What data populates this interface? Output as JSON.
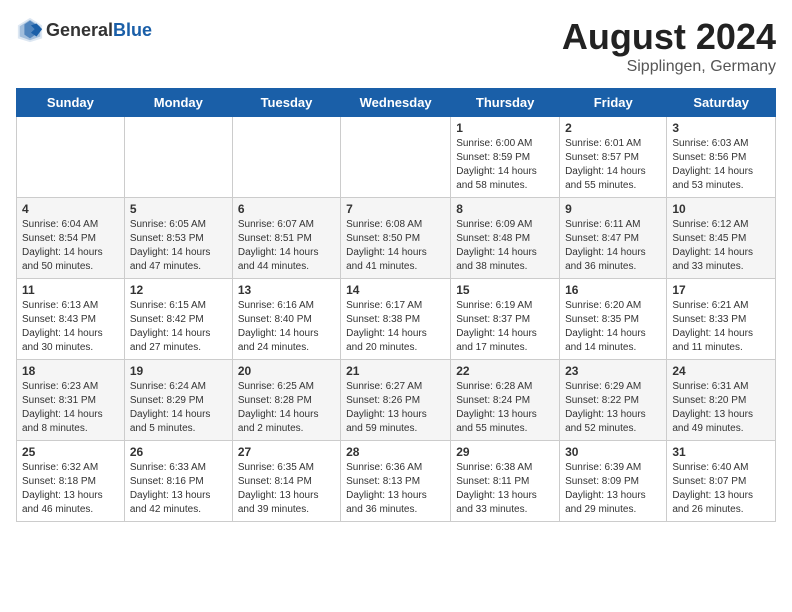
{
  "header": {
    "logo_general": "General",
    "logo_blue": "Blue",
    "month_year": "August 2024",
    "location": "Sipplingen, Germany"
  },
  "weekdays": [
    "Sunday",
    "Monday",
    "Tuesday",
    "Wednesday",
    "Thursday",
    "Friday",
    "Saturday"
  ],
  "weeks": [
    [
      {
        "day": "",
        "sunrise": "",
        "sunset": "",
        "daylight": ""
      },
      {
        "day": "",
        "sunrise": "",
        "sunset": "",
        "daylight": ""
      },
      {
        "day": "",
        "sunrise": "",
        "sunset": "",
        "daylight": ""
      },
      {
        "day": "",
        "sunrise": "",
        "sunset": "",
        "daylight": ""
      },
      {
        "day": "1",
        "sunrise": "Sunrise: 6:00 AM",
        "sunset": "Sunset: 8:59 PM",
        "daylight": "Daylight: 14 hours and 58 minutes."
      },
      {
        "day": "2",
        "sunrise": "Sunrise: 6:01 AM",
        "sunset": "Sunset: 8:57 PM",
        "daylight": "Daylight: 14 hours and 55 minutes."
      },
      {
        "day": "3",
        "sunrise": "Sunrise: 6:03 AM",
        "sunset": "Sunset: 8:56 PM",
        "daylight": "Daylight: 14 hours and 53 minutes."
      }
    ],
    [
      {
        "day": "4",
        "sunrise": "Sunrise: 6:04 AM",
        "sunset": "Sunset: 8:54 PM",
        "daylight": "Daylight: 14 hours and 50 minutes."
      },
      {
        "day": "5",
        "sunrise": "Sunrise: 6:05 AM",
        "sunset": "Sunset: 8:53 PM",
        "daylight": "Daylight: 14 hours and 47 minutes."
      },
      {
        "day": "6",
        "sunrise": "Sunrise: 6:07 AM",
        "sunset": "Sunset: 8:51 PM",
        "daylight": "Daylight: 14 hours and 44 minutes."
      },
      {
        "day": "7",
        "sunrise": "Sunrise: 6:08 AM",
        "sunset": "Sunset: 8:50 PM",
        "daylight": "Daylight: 14 hours and 41 minutes."
      },
      {
        "day": "8",
        "sunrise": "Sunrise: 6:09 AM",
        "sunset": "Sunset: 8:48 PM",
        "daylight": "Daylight: 14 hours and 38 minutes."
      },
      {
        "day": "9",
        "sunrise": "Sunrise: 6:11 AM",
        "sunset": "Sunset: 8:47 PM",
        "daylight": "Daylight: 14 hours and 36 minutes."
      },
      {
        "day": "10",
        "sunrise": "Sunrise: 6:12 AM",
        "sunset": "Sunset: 8:45 PM",
        "daylight": "Daylight: 14 hours and 33 minutes."
      }
    ],
    [
      {
        "day": "11",
        "sunrise": "Sunrise: 6:13 AM",
        "sunset": "Sunset: 8:43 PM",
        "daylight": "Daylight: 14 hours and 30 minutes."
      },
      {
        "day": "12",
        "sunrise": "Sunrise: 6:15 AM",
        "sunset": "Sunset: 8:42 PM",
        "daylight": "Daylight: 14 hours and 27 minutes."
      },
      {
        "day": "13",
        "sunrise": "Sunrise: 6:16 AM",
        "sunset": "Sunset: 8:40 PM",
        "daylight": "Daylight: 14 hours and 24 minutes."
      },
      {
        "day": "14",
        "sunrise": "Sunrise: 6:17 AM",
        "sunset": "Sunset: 8:38 PM",
        "daylight": "Daylight: 14 hours and 20 minutes."
      },
      {
        "day": "15",
        "sunrise": "Sunrise: 6:19 AM",
        "sunset": "Sunset: 8:37 PM",
        "daylight": "Daylight: 14 hours and 17 minutes."
      },
      {
        "day": "16",
        "sunrise": "Sunrise: 6:20 AM",
        "sunset": "Sunset: 8:35 PM",
        "daylight": "Daylight: 14 hours and 14 minutes."
      },
      {
        "day": "17",
        "sunrise": "Sunrise: 6:21 AM",
        "sunset": "Sunset: 8:33 PM",
        "daylight": "Daylight: 14 hours and 11 minutes."
      }
    ],
    [
      {
        "day": "18",
        "sunrise": "Sunrise: 6:23 AM",
        "sunset": "Sunset: 8:31 PM",
        "daylight": "Daylight: 14 hours and 8 minutes."
      },
      {
        "day": "19",
        "sunrise": "Sunrise: 6:24 AM",
        "sunset": "Sunset: 8:29 PM",
        "daylight": "Daylight: 14 hours and 5 minutes."
      },
      {
        "day": "20",
        "sunrise": "Sunrise: 6:25 AM",
        "sunset": "Sunset: 8:28 PM",
        "daylight": "Daylight: 14 hours and 2 minutes."
      },
      {
        "day": "21",
        "sunrise": "Sunrise: 6:27 AM",
        "sunset": "Sunset: 8:26 PM",
        "daylight": "Daylight: 13 hours and 59 minutes."
      },
      {
        "day": "22",
        "sunrise": "Sunrise: 6:28 AM",
        "sunset": "Sunset: 8:24 PM",
        "daylight": "Daylight: 13 hours and 55 minutes."
      },
      {
        "day": "23",
        "sunrise": "Sunrise: 6:29 AM",
        "sunset": "Sunset: 8:22 PM",
        "daylight": "Daylight: 13 hours and 52 minutes."
      },
      {
        "day": "24",
        "sunrise": "Sunrise: 6:31 AM",
        "sunset": "Sunset: 8:20 PM",
        "daylight": "Daylight: 13 hours and 49 minutes."
      }
    ],
    [
      {
        "day": "25",
        "sunrise": "Sunrise: 6:32 AM",
        "sunset": "Sunset: 8:18 PM",
        "daylight": "Daylight: 13 hours and 46 minutes."
      },
      {
        "day": "26",
        "sunrise": "Sunrise: 6:33 AM",
        "sunset": "Sunset: 8:16 PM",
        "daylight": "Daylight: 13 hours and 42 minutes."
      },
      {
        "day": "27",
        "sunrise": "Sunrise: 6:35 AM",
        "sunset": "Sunset: 8:14 PM",
        "daylight": "Daylight: 13 hours and 39 minutes."
      },
      {
        "day": "28",
        "sunrise": "Sunrise: 6:36 AM",
        "sunset": "Sunset: 8:13 PM",
        "daylight": "Daylight: 13 hours and 36 minutes."
      },
      {
        "day": "29",
        "sunrise": "Sunrise: 6:38 AM",
        "sunset": "Sunset: 8:11 PM",
        "daylight": "Daylight: 13 hours and 33 minutes."
      },
      {
        "day": "30",
        "sunrise": "Sunrise: 6:39 AM",
        "sunset": "Sunset: 8:09 PM",
        "daylight": "Daylight: 13 hours and 29 minutes."
      },
      {
        "day": "31",
        "sunrise": "Sunrise: 6:40 AM",
        "sunset": "Sunset: 8:07 PM",
        "daylight": "Daylight: 13 hours and 26 minutes."
      }
    ]
  ]
}
